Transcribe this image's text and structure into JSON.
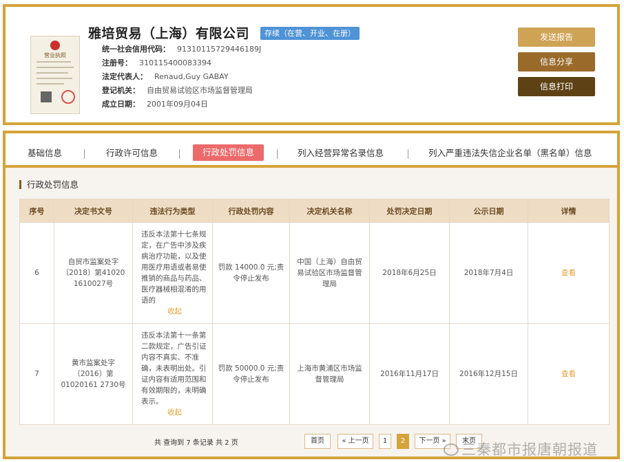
{
  "company": {
    "name": "雅培贸易（上海）有限公司",
    "status": "存续（在营、开业、在册）",
    "license_label": "营业执照",
    "fields": [
      {
        "label": "统一社会信用代码：",
        "value": "91310115729446189J"
      },
      {
        "label": "注册号：",
        "value": "310115400083394"
      },
      {
        "label": "法定代表人：",
        "value": "Renaud,Guy GABAY"
      },
      {
        "label": "登记机关：",
        "value": "自由贸易试验区市场监督管理局"
      },
      {
        "label": "成立日期：",
        "value": "2001年09月04日"
      }
    ]
  },
  "actions": {
    "report": "发送报告",
    "share": "信息分享",
    "print": "信息打印"
  },
  "tabs": [
    "基础信息",
    "行政许可信息",
    "行政处罚信息",
    "列入经营异常名录信息",
    "列入严重违法失信企业名单（黑名单）信息"
  ],
  "section_title": "行政处罚信息",
  "table": {
    "headers": [
      "序号",
      "决定书文号",
      "违法行为类型",
      "行政处罚内容",
      "决定机关名称",
      "处罚决定日期",
      "公示日期",
      "详情"
    ],
    "rows": [
      {
        "no": "6",
        "doc": "自贸市监案处字〔2018〕第41020 1610027号",
        "type": "违反本法第十七条规定，在广告中涉及疾病治疗功能，以及使用医疗用语或者易使推销的商品与药品、医疗器械相混淆的用语的",
        "content": "罚款 14000.0 元;责令停止发布",
        "authority": "中国（上海）自由贸易试验区市场监督管理局",
        "decision_date": "2018年6月25日",
        "publish_date": "2018年7月4日",
        "detail": "查看",
        "collapse": "收起"
      },
      {
        "no": "7",
        "doc": "黄市监案处字〔2016〕第01020161 2730号",
        "type": "违反本法第十一条第二款规定，广告引证内容不真实、不准确，未表明出处。引证内容有适用范围和有效期限的，未明确表示。",
        "content": "罚款 50000.0 元;责令停止发布",
        "authority": "上海市黄浦区市场监督管理局",
        "decision_date": "2016年11月17日",
        "publish_date": "2016年12月15日",
        "detail": "查看",
        "collapse": "收起"
      }
    ]
  },
  "pagination": {
    "summary": "共 查询到 7 条记录 共 2 页",
    "first": "首页",
    "prev": "« 上一页",
    "pages": [
      "1",
      "2"
    ],
    "current": "2",
    "next": "下一页 »",
    "last": "末页"
  },
  "watermark": "三秦都市报唐朝报道",
  "colors": {
    "gold": "#d4a33a",
    "active_tab": "#ec6a6a",
    "badge": "#4e93d6",
    "link": "#e0a23a"
  }
}
